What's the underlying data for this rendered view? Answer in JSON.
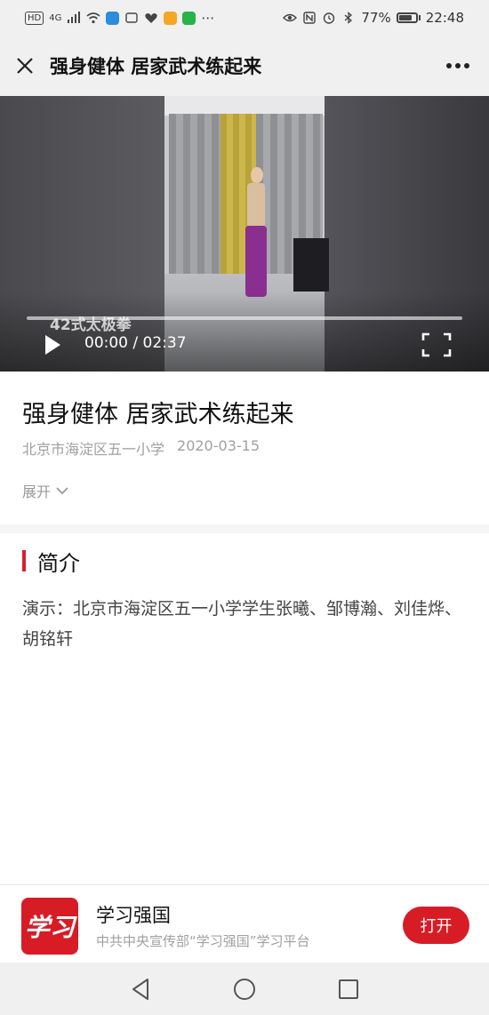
{
  "status_bar": {
    "hd_badge": "HD",
    "network": "4G",
    "battery": "77%",
    "battery_level": 0.77,
    "time": "22:48",
    "icons": [
      "hd-icon",
      "signal-icon",
      "wifi-icon",
      "app-icon",
      "notification-icon",
      "health-icon",
      "app-icon",
      "app-icon",
      "more-icon",
      "eye-icon",
      "nfc-icon",
      "alarm-icon",
      "bluetooth-icon",
      "battery-icon"
    ]
  },
  "title_bar": {
    "title": "强身健体 居家武术练起来",
    "close_icon": "close-icon",
    "more_icon": "more-icon"
  },
  "video": {
    "caption": "42式太极拳",
    "current_time": "00:00",
    "separator": "/",
    "duration": "02:37",
    "progress": 0,
    "play_icon": "play-icon",
    "fullscreen_icon": "fullscreen-icon"
  },
  "article": {
    "title": "强身健体 居家武术练起来",
    "source": "北京市海淀区五一小学",
    "date": "2020-03-15",
    "expand_label": "展开"
  },
  "intro": {
    "heading": "简介",
    "body": "演示：北京市海淀区五一小学学生张曦、邹博瀚、刘佳烨、胡铭轩"
  },
  "app_banner": {
    "logo_text": "学习",
    "name": "学习强国",
    "description": "中共中央宣传部“学习强国”学习平台",
    "open_label": "打开",
    "accent": "#d71c26"
  },
  "nav_bar": {
    "back_icon": "back-icon",
    "home_icon": "home-icon",
    "recents_icon": "recents-icon"
  }
}
